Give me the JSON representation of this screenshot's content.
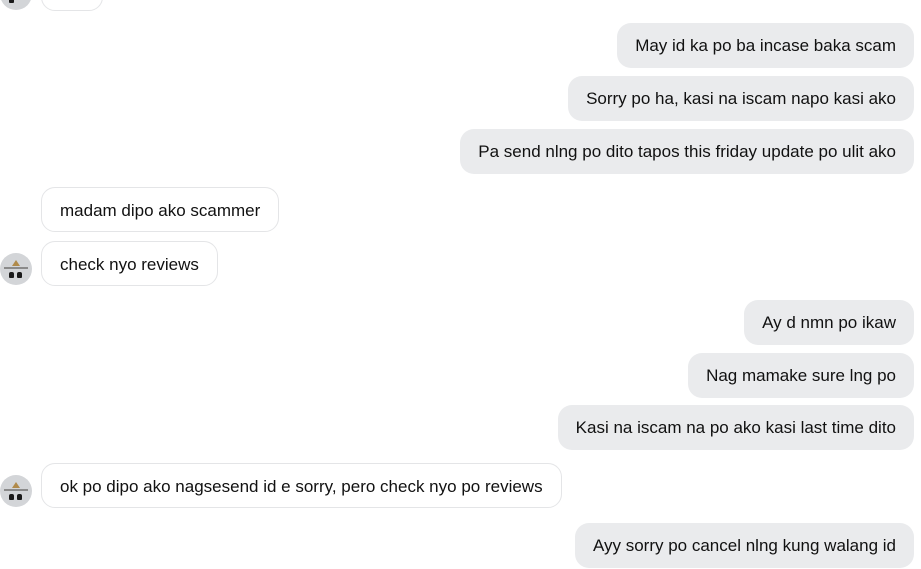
{
  "messages": [
    {
      "text": "May id ka po ba incase baka scam"
    },
    {
      "text": "Sorry po ha, kasi na iscam napo kasi ako"
    },
    {
      "text": "Pa send nlng po dito tapos this friday update po ulit ako"
    },
    {
      "text": "madam dipo ako scammer"
    },
    {
      "text": "check nyo reviews"
    },
    {
      "text": "Ay d nmn po ikaw"
    },
    {
      "text": "Nag mamake sure lng po"
    },
    {
      "text": "Kasi na iscam na po ako kasi last time dito"
    },
    {
      "text": "ok po dipo ako nagsesend id e sorry, pero check nyo po reviews"
    },
    {
      "text": "Ayy sorry po cancel nlng kung walang id"
    }
  ],
  "colors": {
    "outgoing_bubble": "#eaebed",
    "incoming_bubble": "#ffffff",
    "incoming_border": "#e4e5e7",
    "text": "#111111"
  }
}
